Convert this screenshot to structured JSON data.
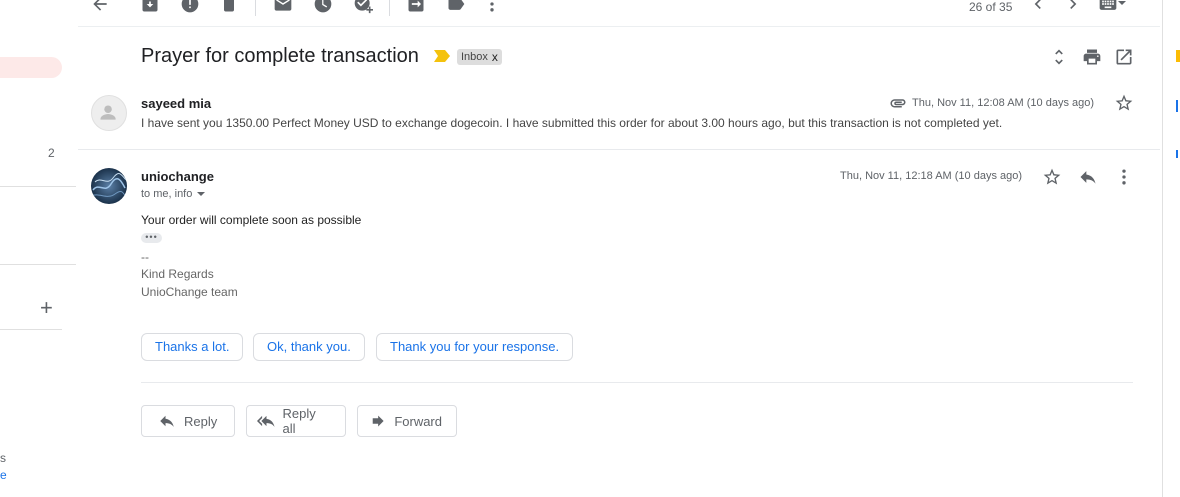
{
  "sidebar": {
    "count": "2",
    "plus": "+",
    "frag1": "s",
    "frag2": "e"
  },
  "toolbar": {
    "icons": [
      "back-arrow-icon",
      "archive-icon",
      "report-spam-icon",
      "delete-icon",
      "mark-unread-icon",
      "snooze-icon",
      "add-to-tasks-icon",
      "move-to-icon",
      "labels-icon",
      "more-vert-icon"
    ],
    "pager_text": "26 of 35"
  },
  "thread": {
    "subject": "Prayer for complete transaction",
    "label": "Inbox",
    "label_close": "x"
  },
  "message1": {
    "sender": "sayeed mia",
    "date": "Thu, Nov 11, 12:08 AM (10 days ago)",
    "snippet": "I have sent you 1350.00 Perfect Money USD to exchange dogecoin. I have submitted this order for about 3.00 hours ago, but this transaction is not completed yet."
  },
  "message2": {
    "sender": "uniochange",
    "recipients": "to me, info",
    "date": "Thu, Nov 11, 12:18 AM (10 days ago)",
    "body": "Your order will complete soon as possible",
    "trimmed": "•••",
    "sig_dash": "--",
    "sig_line1": "Kind Regards",
    "sig_line2": "UnioChange team"
  },
  "smart_replies": [
    "Thanks a lot.",
    "Ok, thank you.",
    "Thank you for your response."
  ],
  "actions": {
    "reply": "Reply",
    "reply_all": "Reply all",
    "forward": "Forward"
  },
  "colors": {
    "accent": "#1a73e8",
    "important_marker": "#f4c20d",
    "icon_gray": "#5f6368"
  }
}
